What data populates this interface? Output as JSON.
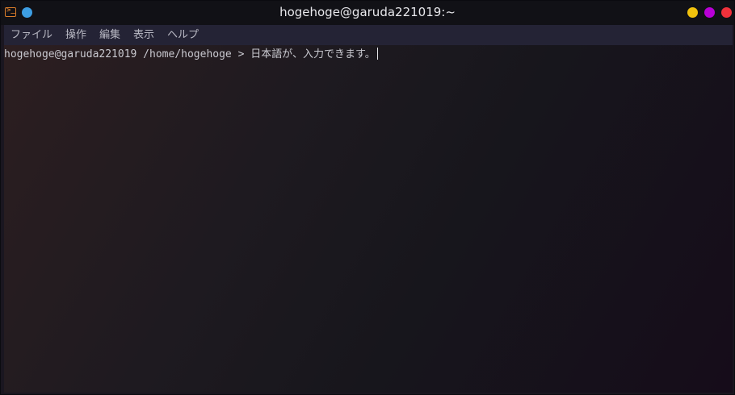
{
  "window": {
    "title": "hogehoge@garuda221019:~",
    "app_icon": "terminal-icon",
    "prompt_glyph": ">_",
    "buttons": [
      "minimize",
      "maximize",
      "close"
    ],
    "colors": {
      "minimize": "#f1c20d",
      "maximize": "#b800d6",
      "close": "#f0313b",
      "pin": "#3d9ee3",
      "app_icon": "#d97c2a"
    }
  },
  "menubar": {
    "items": [
      "ファイル",
      "操作",
      "編集",
      "表示",
      "ヘルプ"
    ]
  },
  "terminal": {
    "prompt": "hogehoge@garuda221019 /home/hogehoge > ",
    "input": "日本語が、入力できます。"
  }
}
